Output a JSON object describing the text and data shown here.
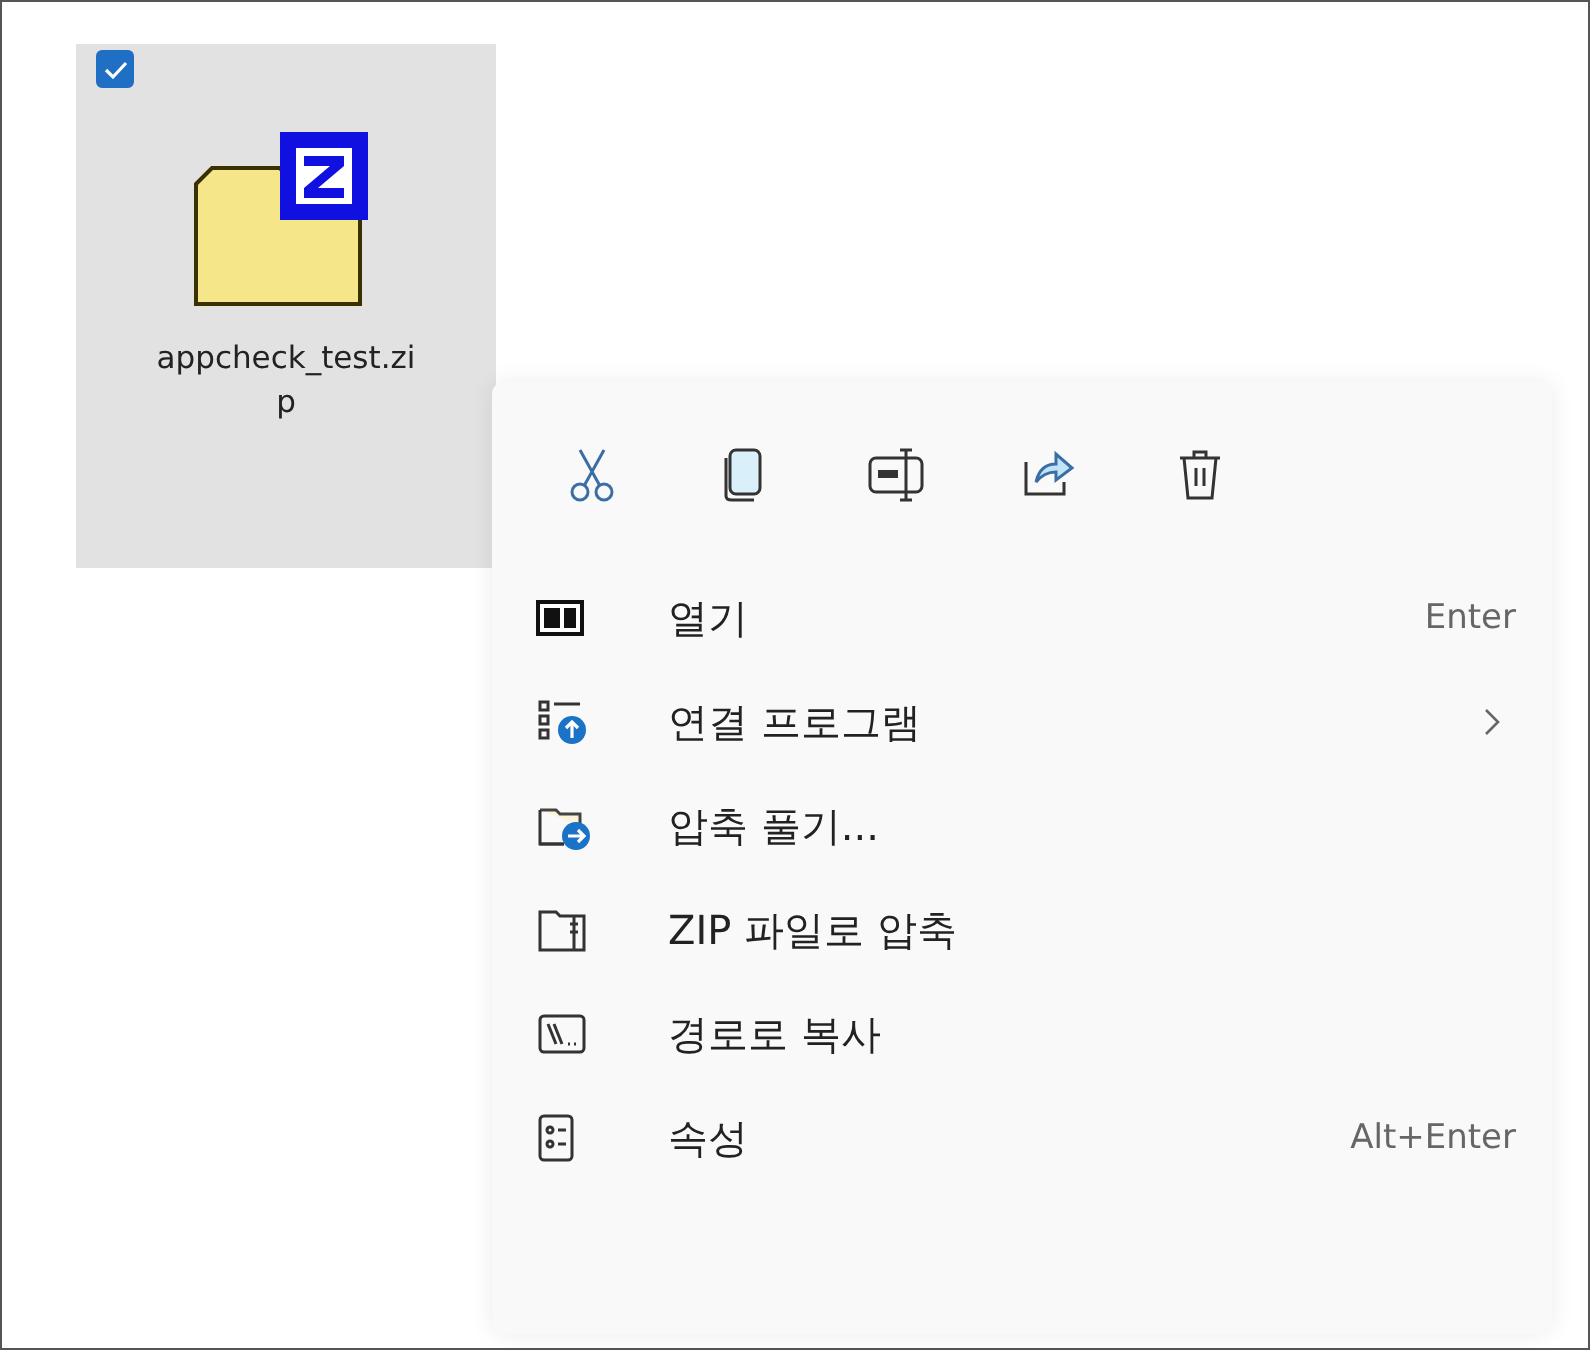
{
  "file": {
    "name": "appcheck_test.zip",
    "selected": true,
    "checked": true
  },
  "context_menu": {
    "toolbar": [
      {
        "kind": "cut"
      },
      {
        "kind": "copy"
      },
      {
        "kind": "rename"
      },
      {
        "kind": "share"
      },
      {
        "kind": "delete"
      }
    ],
    "items": [
      {
        "kind": "open",
        "label": "열기",
        "shortcut": "Enter",
        "submenu": false
      },
      {
        "kind": "open-with",
        "label": "연결 프로그램",
        "submenu": true
      },
      {
        "kind": "extract",
        "label": "압축 풀기...",
        "submenu": false
      },
      {
        "kind": "zip",
        "label": "ZIP 파일로 압축",
        "submenu": false
      },
      {
        "kind": "copy-path",
        "label": "경로로 복사",
        "submenu": false
      },
      {
        "kind": "properties",
        "label": "속성",
        "shortcut": "Alt+Enter",
        "submenu": false
      }
    ]
  }
}
